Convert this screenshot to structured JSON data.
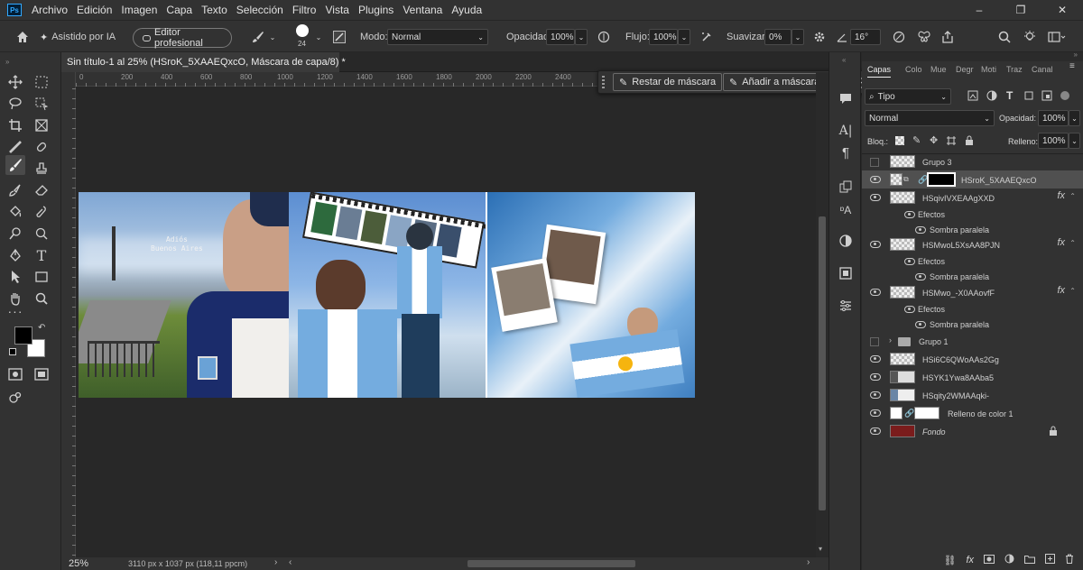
{
  "menu": [
    "Archivo",
    "Edición",
    "Imagen",
    "Capa",
    "Texto",
    "Selección",
    "Filtro",
    "Vista",
    "Plugins",
    "Ventana",
    "Ayuda"
  ],
  "window_controls": [
    "–",
    "❐",
    "✕"
  ],
  "options": {
    "ai_assist": "Asistido por IA",
    "pro_editor": "Editor profesional",
    "brush_size": "24",
    "mode_label": "Modo:",
    "mode_value": "Normal",
    "opacity_label": "Opacidad:",
    "opacity_value": "100%",
    "flow_label": "Flujo:",
    "flow_value": "100%",
    "smooth_label": "Suavizar:",
    "smooth_value": "0%",
    "angle_value": "16°"
  },
  "document_tab": "Sin título-1 al 25% (HSroK_5XAAEQxcO, Máscara de capa/8) *",
  "ruler_ticks": [
    "0",
    "200",
    "400",
    "600",
    "800",
    "1000",
    "1200",
    "1400",
    "1600",
    "1800",
    "2000",
    "2200",
    "2400"
  ],
  "mask_bar": {
    "subtract": "Restar de máscara",
    "add": "Añadir a máscara",
    "more": "···"
  },
  "canvas_overlay_text": [
    "Adiós",
    "Buenos Aires"
  ],
  "status": {
    "zoom": "25%",
    "dimensions": "3110 px x 1037 px (118,11 ppcm)"
  },
  "layers_panel": {
    "tabs": [
      "Capas",
      "Colo",
      "Mue",
      "Degr",
      "Moti",
      "Traz",
      "Canal"
    ],
    "filter_kind": "Tipo",
    "blend_mode": "Normal",
    "opacity_label": "Opacidad:",
    "opacity_value": "100%",
    "lock_label": "Bloq.:",
    "fill_label": "Relleno:",
    "fill_value": "100%",
    "layers": [
      {
        "name": "Grupo 3",
        "kind": "group-hidden"
      },
      {
        "name": "HSroK_5XAAEQxcO",
        "kind": "masked",
        "selected": true
      },
      {
        "name": "HSqivIVXEAAgXXD",
        "kind": "fx"
      },
      {
        "name": "Efectos",
        "kind": "effects"
      },
      {
        "name": "Sombra paralela",
        "kind": "effect"
      },
      {
        "name": "HSMwoL5XsAA8PJN",
        "kind": "fx"
      },
      {
        "name": "Efectos",
        "kind": "effects"
      },
      {
        "name": "Sombra paralela",
        "kind": "effect"
      },
      {
        "name": "HSMwo_-X0AAovfF",
        "kind": "fx"
      },
      {
        "name": "Efectos",
        "kind": "effects"
      },
      {
        "name": "Sombra paralela",
        "kind": "effect"
      },
      {
        "name": "Grupo 1",
        "kind": "group"
      },
      {
        "name": "HSi6C6QWoAAs2Gg",
        "kind": "layer"
      },
      {
        "name": "HSYK1Ywa8AAba5",
        "kind": "layer"
      },
      {
        "name": "HSqity2WMAAqki-",
        "kind": "layer"
      },
      {
        "name": "Relleno de color 1",
        "kind": "fill"
      },
      {
        "name": "Fondo",
        "kind": "background"
      }
    ]
  },
  "colors": {
    "accent": "#31a8ff",
    "background_layer": "#7a1c1c",
    "sky_blue": "#74acdf"
  }
}
